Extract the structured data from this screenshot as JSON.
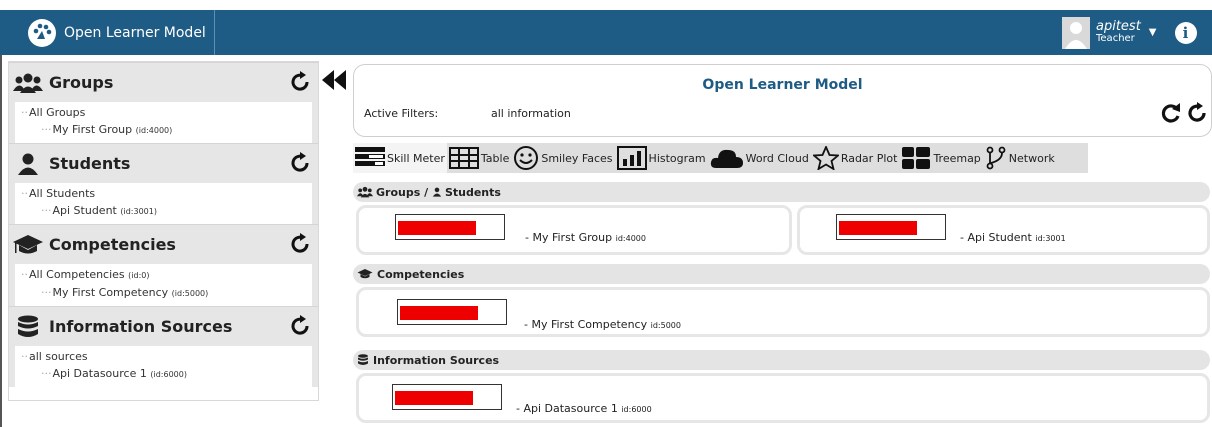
{
  "header": {
    "app_title": "Open Learner Model",
    "user_name": "apitest",
    "user_role": "Teacher"
  },
  "sidebar": {
    "sections": [
      {
        "title": "Groups",
        "root": "All Groups",
        "child": "My First Group",
        "child_id": "(id:4000)"
      },
      {
        "title": "Students",
        "root": "All Students",
        "child": "Api Student",
        "child_id": "(id:3001)"
      },
      {
        "title": "Competencies",
        "root": "All Competencies",
        "root_id": "(id:0)",
        "child": "My First Competency",
        "child_id": "(id:5000)"
      },
      {
        "title": "Information Sources",
        "root": "all sources",
        "child": "Api Datasource 1",
        "child_id": "(id:6000)"
      }
    ]
  },
  "filters": {
    "title": "Open Learner Model",
    "label": "Active Filters:",
    "value": "all information"
  },
  "views": [
    {
      "label": "Skill Meter",
      "active": true
    },
    {
      "label": "Table"
    },
    {
      "label": "Smiley Faces"
    },
    {
      "label": "Histogram"
    },
    {
      "label": "Word Cloud"
    },
    {
      "label": "Radar Plot"
    },
    {
      "label": "Treemap"
    },
    {
      "label": "Network"
    }
  ],
  "groups": {
    "groups_students": {
      "title_a": "Groups",
      "title_b": "Students",
      "items": [
        {
          "name": "My First Group",
          "id": "id:4000",
          "value": 0.75
        },
        {
          "name": "Api Student",
          "id": "id:3001",
          "value": 0.75
        }
      ]
    },
    "competencies": {
      "title": "Competencies",
      "items": [
        {
          "name": "My First Competency",
          "id": "id:5000",
          "value": 0.75
        }
      ]
    },
    "sources": {
      "title": "Information Sources",
      "items": [
        {
          "name": "Api Datasource 1",
          "id": "id:6000",
          "value": 0.75
        }
      ]
    }
  },
  "colors": {
    "brand": "#1e5b85",
    "meter_fill": "#ee0000"
  }
}
